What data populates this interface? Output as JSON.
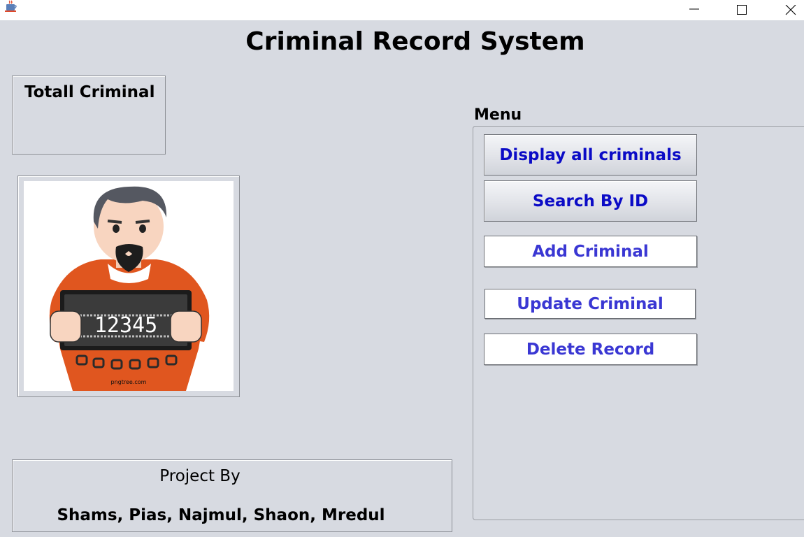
{
  "window": {
    "icons": {
      "app": "java-cup-icon",
      "minimize": "minimize-icon",
      "maximize": "maximize-icon",
      "close": "close-icon"
    }
  },
  "title": "Criminal Record System",
  "total": {
    "label": "Totall Criminal"
  },
  "image": {
    "watermark": "pngtree.com",
    "board_number": "12345"
  },
  "credits": {
    "heading": "Project By",
    "names": "Shams, Pias, Najmul, Shaon, Mredul"
  },
  "menu": {
    "label": "Menu",
    "buttons": [
      {
        "label": "Display all criminals"
      },
      {
        "label": "Search By ID"
      },
      {
        "label": "Add Criminal"
      },
      {
        "label": "Update Criminal"
      },
      {
        "label": "Delete Record"
      }
    ]
  },
  "colors": {
    "background": "#d7dae1",
    "button_text": "#0b0bc6",
    "button_text_flat": "#3a37d3"
  }
}
